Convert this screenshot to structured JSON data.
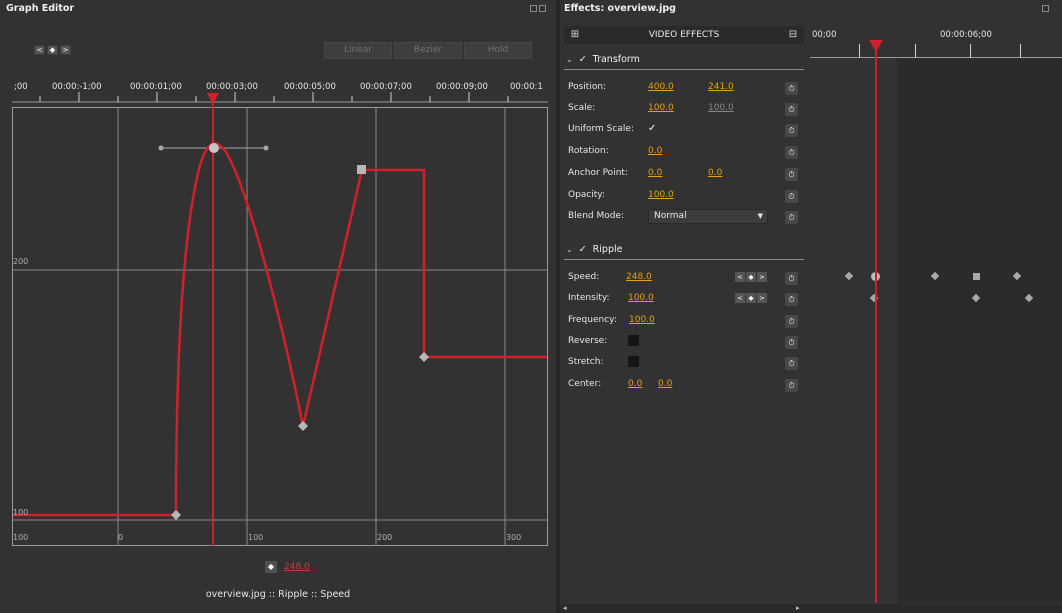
{
  "graph_editor": {
    "title": "Graph Editor",
    "nav_buttons": [
      "<",
      "◆",
      ">"
    ],
    "interp_buttons": [
      "Linear",
      "Bezier",
      "Hold"
    ],
    "ruler_labels": [
      ";00",
      "00:00:-1;00",
      "00:00:01;00",
      "00:00:03;00",
      "00:00:05;00",
      "00:00:07;00",
      "00:00:09;00",
      "00:00:1"
    ],
    "value_labels": [
      "200",
      "100"
    ],
    "bottom_labels": [
      "100",
      "0",
      "100",
      "200",
      "300"
    ],
    "value_button": "◆",
    "current_value": "248.0",
    "caption": "overview.jpg :: Ripple :: Speed",
    "curve_color": "#d0202c"
  },
  "effects": {
    "title": "Effects: overview.jpg",
    "header_label": "VIDEO EFFECTS",
    "transform": {
      "name": "Transform",
      "checked": "✓",
      "position": {
        "label": "Position:",
        "x": "400.0",
        "y": "241.0"
      },
      "scale": {
        "label": "Scale:",
        "x": "100.0",
        "y": "100.0"
      },
      "uniform_scale": {
        "label": "Uniform Scale:",
        "value": "✓"
      },
      "rotation": {
        "label": "Rotation:",
        "value": "0.0"
      },
      "anchor_point": {
        "label": "Anchor Point:",
        "x": "0.0",
        "y": "0.0"
      },
      "opacity": {
        "label": "Opacity:",
        "value": "100.0"
      },
      "blend_mode": {
        "label": "Blend Mode:",
        "value": "Normal"
      }
    },
    "ripple": {
      "name": "Ripple",
      "checked": "✓",
      "speed": {
        "label": "Speed:",
        "value": "248.0"
      },
      "intensity": {
        "label": "Intensity:",
        "value": "100.0"
      },
      "frequency": {
        "label": "Frequency:",
        "value": "100.0"
      },
      "reverse": {
        "label": "Reverse:"
      },
      "stretch": {
        "label": "Stretch:"
      },
      "center": {
        "label": "Center:",
        "x": "0.0",
        "y": "0.0"
      }
    },
    "reset_icon": "⏱",
    "kf_nav": [
      "<",
      "◆",
      ">"
    ],
    "accent_color": "#e8a010"
  },
  "keyframe_timeline": {
    "time_labels": [
      "00;00",
      "00:00:06;00"
    ]
  }
}
